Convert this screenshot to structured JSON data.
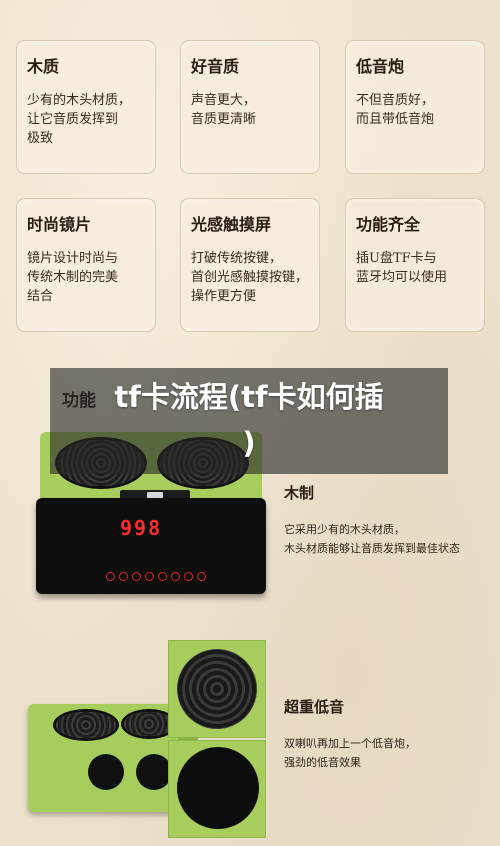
{
  "features": [
    {
      "title": "木质",
      "desc": "少有的木头材质，\n让它音质发挥到\n极致"
    },
    {
      "title": "好音质",
      "desc": "声音更大，\n音质更清晰"
    },
    {
      "title": "低音炮",
      "desc": "不但音质好，\n而且带低音炮"
    },
    {
      "title": "时尚镜片",
      "desc": "镜片设计时尚与\n传统木制的完美\n结合"
    },
    {
      "title": "光感触摸屏",
      "desc": "打破传统按键，\n首创光感触摸按键，\n操作更方便"
    },
    {
      "title": "功能齐全",
      "desc": "插U盘TF卡与\n蓝牙均可以使用"
    }
  ],
  "behind_label": "功能",
  "display_value": "998",
  "product_features": [
    {
      "title": "木制",
      "desc": "它采用少有的木头材质，\n木头材质能够让音质发挥到最佳状态"
    },
    {
      "title": "超重低音",
      "desc": "双喇叭再加上一个低音炮，\n强劲的低音效果"
    }
  ],
  "overlay_title": "tf卡流程(tf卡如何插\n)"
}
